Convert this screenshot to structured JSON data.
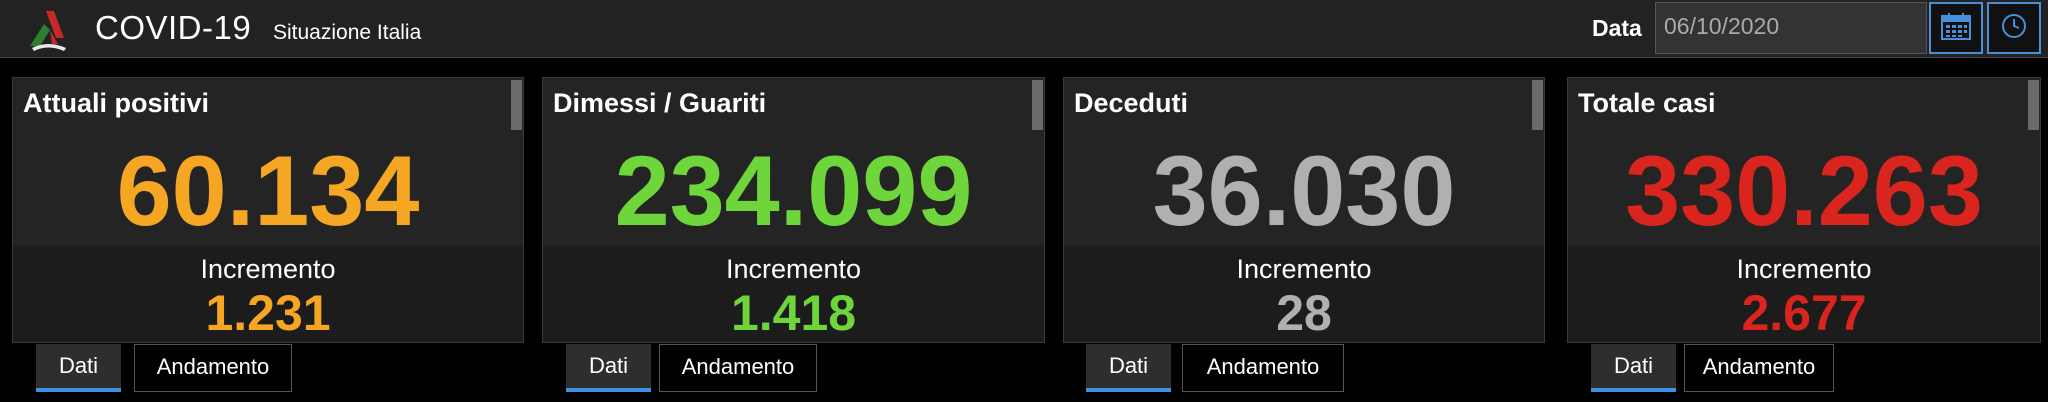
{
  "header": {
    "title": "COVID-19",
    "subtitle": "Situazione Italia",
    "date_label": "Data",
    "date_value": "06/10/2020"
  },
  "icons": {
    "logo": "italy-emblem-icon",
    "calendar": "calendar-icon",
    "clock": "clock-icon"
  },
  "colors": {
    "positivi": "#f5a623",
    "guariti": "#6ed53b",
    "deceduti": "#b0b0b0",
    "totale": "#d9251d",
    "accent": "#3f8fe0"
  },
  "cards": [
    {
      "title": "Attuali positivi",
      "value": "60.134",
      "increment_label": "Incremento",
      "increment": "1.231",
      "tabs": [
        "Dati",
        "Andamento"
      ]
    },
    {
      "title": "Dimessi / Guariti",
      "value": "234.099",
      "increment_label": "Incremento",
      "increment": "1.418",
      "tabs": [
        "Dati",
        "Andamento"
      ]
    },
    {
      "title": "Deceduti",
      "value": "36.030",
      "increment_label": "Incremento",
      "increment": "28",
      "tabs": [
        "Dati",
        "Andamento"
      ]
    },
    {
      "title": "Totale casi",
      "value": "330.263",
      "increment_label": "Incremento",
      "increment": "2.677",
      "tabs": [
        "Dati",
        "Andamento"
      ]
    }
  ]
}
